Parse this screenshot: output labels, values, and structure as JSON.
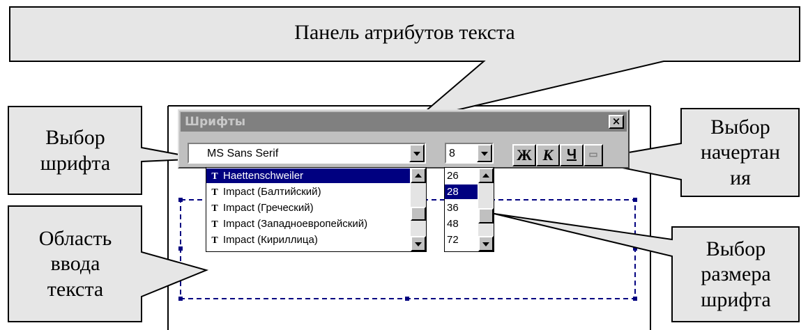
{
  "callouts": {
    "panel_title": "Панель атрибутов текста",
    "font_choice": "Выбор\nшрифта",
    "text_area": "Область\nввода\nтекста",
    "style_choice": "Выбор\nначертан\nия",
    "size_choice": "Выбор\nразмера\nшрифта"
  },
  "toolbar": {
    "title": "Шрифты",
    "close_label": "×",
    "font_value": "MS Sans Serif",
    "size_value": "8",
    "bold_label": "Ж",
    "italic_label": "К",
    "underline_label": "Ч",
    "more_label": "▭"
  },
  "font_list": {
    "items": [
      {
        "label": "Haettenschweiler",
        "selected": true
      },
      {
        "label": "Impact (Балтийский)",
        "selected": false
      },
      {
        "label": "Impact (Греческий)",
        "selected": false
      },
      {
        "label": "Impact (Западноевропейский)",
        "selected": false
      },
      {
        "label": "Impact (Кириллица)",
        "selected": false
      }
    ],
    "icon": "truetype-icon"
  },
  "size_list": {
    "items": [
      {
        "label": "26",
        "selected": false
      },
      {
        "label": "28",
        "selected": true
      },
      {
        "label": "36",
        "selected": false
      },
      {
        "label": "48",
        "selected": false
      },
      {
        "label": "72",
        "selected": false
      }
    ]
  },
  "colors": {
    "callout_fill": "#e6e6e6",
    "selection": "#000080",
    "frame_dash": "#000080"
  }
}
